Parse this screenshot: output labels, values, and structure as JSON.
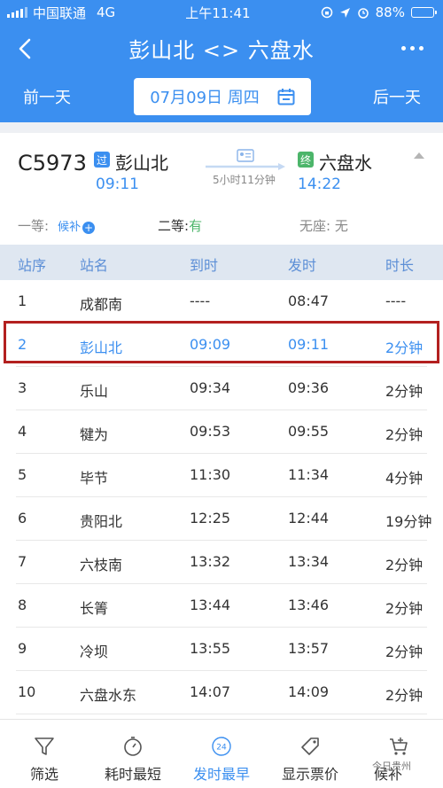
{
  "status_bar": {
    "carrier": "中国联通",
    "network": "4G",
    "time": "上午11:41",
    "battery": "88%",
    "battery_level": 0.88
  },
  "nav": {
    "title": "彭山北 <> 六盘水"
  },
  "date_bar": {
    "prev_label": "前一天",
    "date": "07月09日 周四",
    "next_label": "后一天"
  },
  "train": {
    "number": "C5973",
    "from_badge": "过",
    "from_station": "彭山北",
    "from_time": "09:11",
    "duration": "5小时11分钟",
    "to_badge": "终",
    "to_station": "六盘水",
    "to_time": "14:22"
  },
  "seats": {
    "first_label": "一等:",
    "first_value": "候补",
    "first_plus": "+",
    "second_label": "二等:",
    "second_value": "有",
    "none_label": "无座:",
    "none_value": "无"
  },
  "table": {
    "headers": [
      "站序",
      "站名",
      "到时",
      "发时",
      "时长"
    ],
    "rows": [
      [
        "1",
        "成都南",
        "----",
        "08:47",
        "----"
      ],
      [
        "2",
        "彭山北",
        "09:09",
        "09:11",
        "2分钟"
      ],
      [
        "3",
        "乐山",
        "09:34",
        "09:36",
        "2分钟"
      ],
      [
        "4",
        "犍为",
        "09:53",
        "09:55",
        "2分钟"
      ],
      [
        "5",
        "毕节",
        "11:30",
        "11:34",
        "4分钟"
      ],
      [
        "6",
        "贵阳北",
        "12:25",
        "12:44",
        "19分钟"
      ],
      [
        "7",
        "六枝南",
        "13:32",
        "13:34",
        "2分钟"
      ],
      [
        "8",
        "长箐",
        "13:44",
        "13:46",
        "2分钟"
      ],
      [
        "9",
        "冷坝",
        "13:55",
        "13:57",
        "2分钟"
      ],
      [
        "10",
        "六盘水东",
        "14:07",
        "14:09",
        "2分钟"
      ]
    ]
  },
  "tabbar": {
    "filter": "筛选",
    "shortest": "耗时最短",
    "earliest": "发时最早",
    "earliest_icon_text": "24",
    "show_price": "显示票价",
    "waitlist": "候补"
  },
  "watermark": "今日贵州",
  "colors": {
    "brand_blue": "#3b8ff0",
    "highlight_red": "#b3201f",
    "green": "#4cb56a"
  }
}
